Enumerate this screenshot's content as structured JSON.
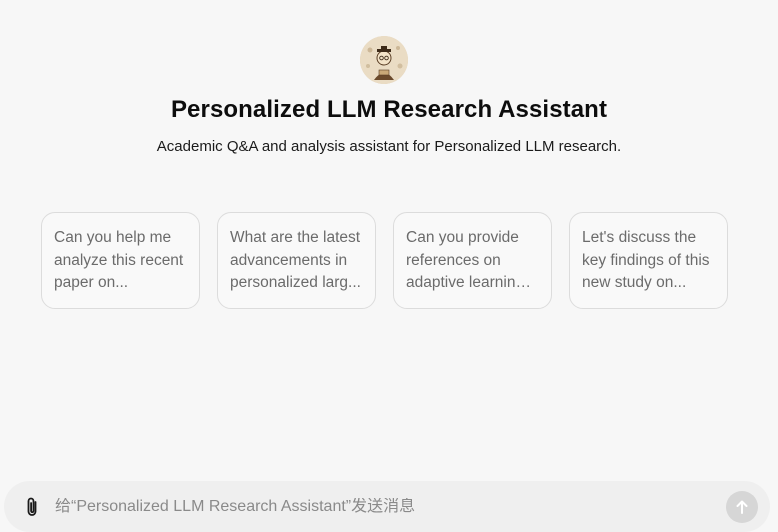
{
  "assistant": {
    "name": "Personalized LLM Research Assistant",
    "description": "Academic Q&A and analysis assistant for Personalized LLM research.",
    "avatar_icon": "scholar-avatar"
  },
  "suggestions": [
    {
      "text": "Can you help me analyze this recent paper on..."
    },
    {
      "text": "What are the latest advancements in personalized larg..."
    },
    {
      "text": "Can you provide references on adaptive learning ..."
    },
    {
      "text": "Let's discuss the key findings of this new study on..."
    }
  ],
  "composer": {
    "placeholder": "给“Personalized LLM Research Assistant”发送消息",
    "value": "",
    "attach_icon": "paperclip-icon",
    "send_icon": "arrow-up-icon"
  },
  "colors": {
    "background": "#f7f7f7",
    "card_border": "#dcdcdc",
    "send_button": "#d6d6d6"
  }
}
